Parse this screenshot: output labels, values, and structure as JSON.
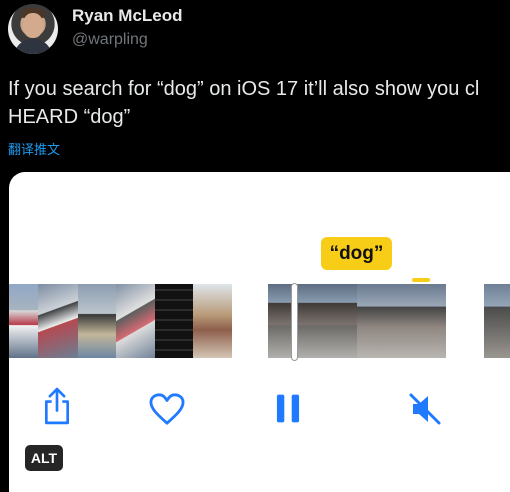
{
  "author": {
    "display_name": "Ryan McLeod",
    "handle": "@warpling"
  },
  "tweet": {
    "line1": "If you search for “dog” on iOS 17 it’ll also show you cl",
    "line2": "HEARD “dog”",
    "translate_label": "翻译推文"
  },
  "media": {
    "query_label": "“dog”",
    "alt_label": "ALT"
  },
  "icons": {
    "share": "share-icon",
    "like": "heart-icon",
    "pause": "pause-icon",
    "mute": "speaker-muted-icon"
  },
  "colors": {
    "accent_blue": "#1d9bf0",
    "highlight_yellow": "#f8cd18",
    "ios_blue": "#1f7aff"
  }
}
